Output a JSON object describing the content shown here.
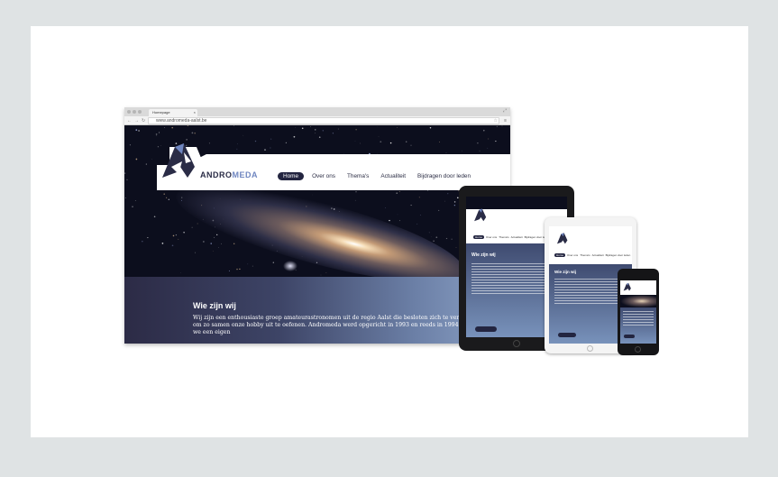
{
  "colors": {
    "background": "#dfe3e4",
    "card": "#ffffff",
    "navy": "#232540",
    "accent": "#6f86c0"
  },
  "browser": {
    "tab_title": "Homepage",
    "tab_close": "×",
    "window_controls": "⤢",
    "back_icon": "←",
    "forward_icon": "→",
    "reload_icon": "↻",
    "url": "www.andromeda-aalst.be",
    "star_icon": "☆",
    "menu_icon": "≡"
  },
  "site": {
    "logo_main": "ANDRO",
    "logo_accent": "MEDA",
    "nav": [
      "Home",
      "Over ons",
      "Thema's",
      "Actualiteit",
      "Bijdragen door leden"
    ],
    "section_title": "Wie zijn wij",
    "section_text": "Wij zijn een enthousiaste groep amateurastronomen uit de regio Aalst die besloten zich te verenigen om zo samen onze hobby uit te oefenen. Andromeda werd opgericht in 1993 en reeds in 1994 hadden we een eigen"
  },
  "tablet": {
    "nav": [
      "Home",
      "Over ons",
      "Thema's",
      "Actualiteit",
      "Bijdragen door leden"
    ],
    "section_title": "Wie zijn wij"
  },
  "ipad": {
    "nav": [
      "Home",
      "Over ons",
      "Thema's",
      "Actualiteit",
      "Bijdragen door leden"
    ],
    "section_title": "Wie zijn wij"
  }
}
